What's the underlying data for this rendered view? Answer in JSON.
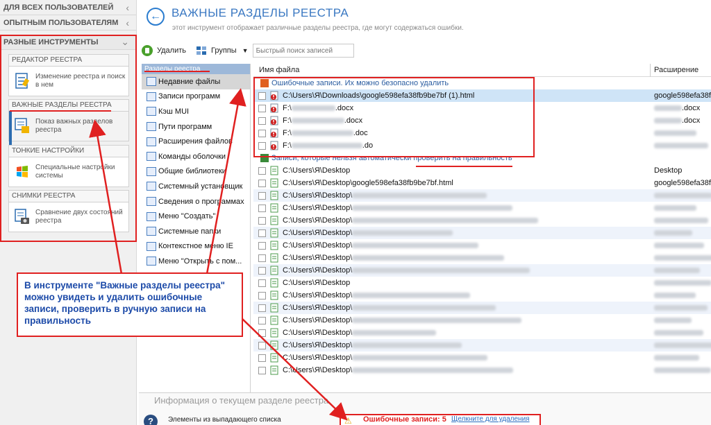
{
  "left_panel": {
    "top_groups": [
      {
        "label": "ДЛЯ ВСЕХ ПОЛЬЗОВАТЕЛЕЙ"
      },
      {
        "label": "ОПЫТНЫМ ПОЛЬЗОВАТЕЛЯМ"
      },
      {
        "label": "РАЗНЫЕ ИНСТРУМЕНТЫ"
      }
    ],
    "tools": [
      {
        "title": "РЕДАКТОР РЕЕСТРА",
        "desc": "Изменение реестра и поиск в нем"
      },
      {
        "title": "ВАЖНЫЕ РАЗДЕЛЫ РЕЕСТРА",
        "desc": "Показ важных разделов реестра"
      },
      {
        "title": "ТОНКИЕ НАСТРОЙКИ",
        "desc": "Специальные настройки системы"
      },
      {
        "title": "СНИМКИ РЕЕСТРА",
        "desc": "Сравнение двух состояний реестра"
      }
    ]
  },
  "header": {
    "title": "ВАЖНЫЕ РАЗДЕЛЫ РЕЕСТРА",
    "subtitle": "этот инструмент отображает различные разделы реестра, где могут содержаться ошибки."
  },
  "toolbar": {
    "delete_label": "Удалить",
    "groups_label": "Группы",
    "search_placeholder": "Быстрый поиск записей"
  },
  "sections": {
    "header": "Разделы реестра",
    "items": [
      "Недавние файлы",
      "Записи программ",
      "Кэш MUI",
      "Пути программ",
      "Расширения файлов",
      "Команды оболочки",
      "Общие библиотеки",
      "Системный установщик",
      "Сведения о программах",
      "Меню \"Создать\"",
      "Системные папки",
      "Контекстное меню IE",
      "Меню \"Открыть с пом..."
    ]
  },
  "grid": {
    "col_name": "Имя файла",
    "col_ext": "Расширение",
    "group_errors": "Ошибочные записи. Их можно безопасно удалить",
    "error_rows": [
      {
        "path": "C:\\Users\\Я\\Downloads\\google598efa38fb9be7bf (1).html",
        "ext": "google598efa38f"
      },
      {
        "path": "F:\\",
        "suffix": ".docx",
        "ext": ".docx"
      },
      {
        "path": "F:\\",
        "suffix": ".docx",
        "ext": ".docx"
      },
      {
        "path": "F:\\",
        "suffix": ".doc",
        "ext": ""
      },
      {
        "path": "F:\\",
        "suffix": ".do",
        "ext": ""
      }
    ],
    "group_manual": "Записи, которые нельзя автоматически проверить на правильность",
    "manual_rows": [
      {
        "path": "C:\\Users\\Я\\Desktop",
        "ext": "Desktop"
      },
      {
        "path": "C:\\Users\\Я\\Desktop\\google598efa38fb9be7bf.html",
        "ext": "google598efa38f"
      },
      {
        "path": "C:\\Users\\Я\\Desktop\\",
        "ext": ""
      },
      {
        "path": "C:\\Users\\Я\\Desktop\\",
        "ext": ""
      },
      {
        "path": "C:\\Users\\Я\\Desktop\\",
        "ext": ""
      },
      {
        "path": "C:\\Users\\Я\\Desktop\\",
        "ext": ""
      },
      {
        "path": "C:\\Users\\Я\\Desktop\\",
        "ext": ""
      },
      {
        "path": "C:\\Users\\Я\\Desktop\\",
        "ext": ""
      },
      {
        "path": "C:\\Users\\Я\\Desktop\\",
        "ext": ""
      },
      {
        "path": "C:\\Users\\Я\\Desktop",
        "ext": ""
      },
      {
        "path": "C:\\Users\\Я\\Desktop\\",
        "ext": ""
      },
      {
        "path": "C:\\Users\\Я\\Desktop\\",
        "ext": ""
      },
      {
        "path": "C:\\Users\\Я\\Desktop\\",
        "ext": ""
      },
      {
        "path": "C:\\Users\\Я\\Desktop\\",
        "ext": ""
      },
      {
        "path": "C:\\Users\\Я\\Desktop\\",
        "ext": ""
      },
      {
        "path": "C:\\Users\\Я\\Desktop\\",
        "ext": ""
      },
      {
        "path": "C:\\Users\\Я\\Desktop\\",
        "ext": ""
      }
    ]
  },
  "info": {
    "title": "Информация о текущем разделе реестра",
    "item_text": "Элементы из выпадающего списка",
    "errors_label": "Ошибочные записи: 5",
    "errors_link": "Щелкните для удаления"
  },
  "callout": {
    "text": "В инструменте \"Важные разделы реестра\" можно увидеть и удалить ошибочные записи, проверить в ручную записи на правильность"
  },
  "colors": {
    "accent": "#3a78c2",
    "annotation": "#e02020",
    "selection": "#cfe4f7"
  }
}
